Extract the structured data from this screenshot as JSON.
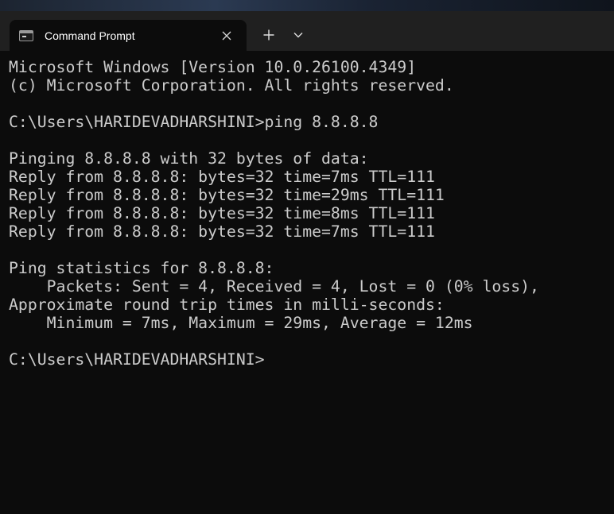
{
  "tab": {
    "title": "Command Prompt",
    "icon": "command-prompt-icon"
  },
  "titlebar": {
    "close_icon": "close-icon",
    "new_tab_icon": "plus-icon",
    "dropdown_icon": "chevron-down-icon"
  },
  "terminal": {
    "text_color": "#cccccc",
    "background": "#0c0c0c",
    "lines": [
      "Microsoft Windows [Version 10.0.26100.4349]",
      "(c) Microsoft Corporation. All rights reserved.",
      "",
      "C:\\Users\\HARIDEVADHARSHINI>ping 8.8.8.8",
      "",
      "Pinging 8.8.8.8 with 32 bytes of data:",
      "Reply from 8.8.8.8: bytes=32 time=7ms TTL=111",
      "Reply from 8.8.8.8: bytes=32 time=29ms TTL=111",
      "Reply from 8.8.8.8: bytes=32 time=8ms TTL=111",
      "Reply from 8.8.8.8: bytes=32 time=7ms TTL=111",
      "",
      "Ping statistics for 8.8.8.8:",
      "    Packets: Sent = 4, Received = 4, Lost = 0 (0% loss),",
      "Approximate round trip times in milli-seconds:",
      "    Minimum = 7ms, Maximum = 29ms, Average = 12ms",
      "",
      "C:\\Users\\HARIDEVADHARSHINI>"
    ]
  }
}
